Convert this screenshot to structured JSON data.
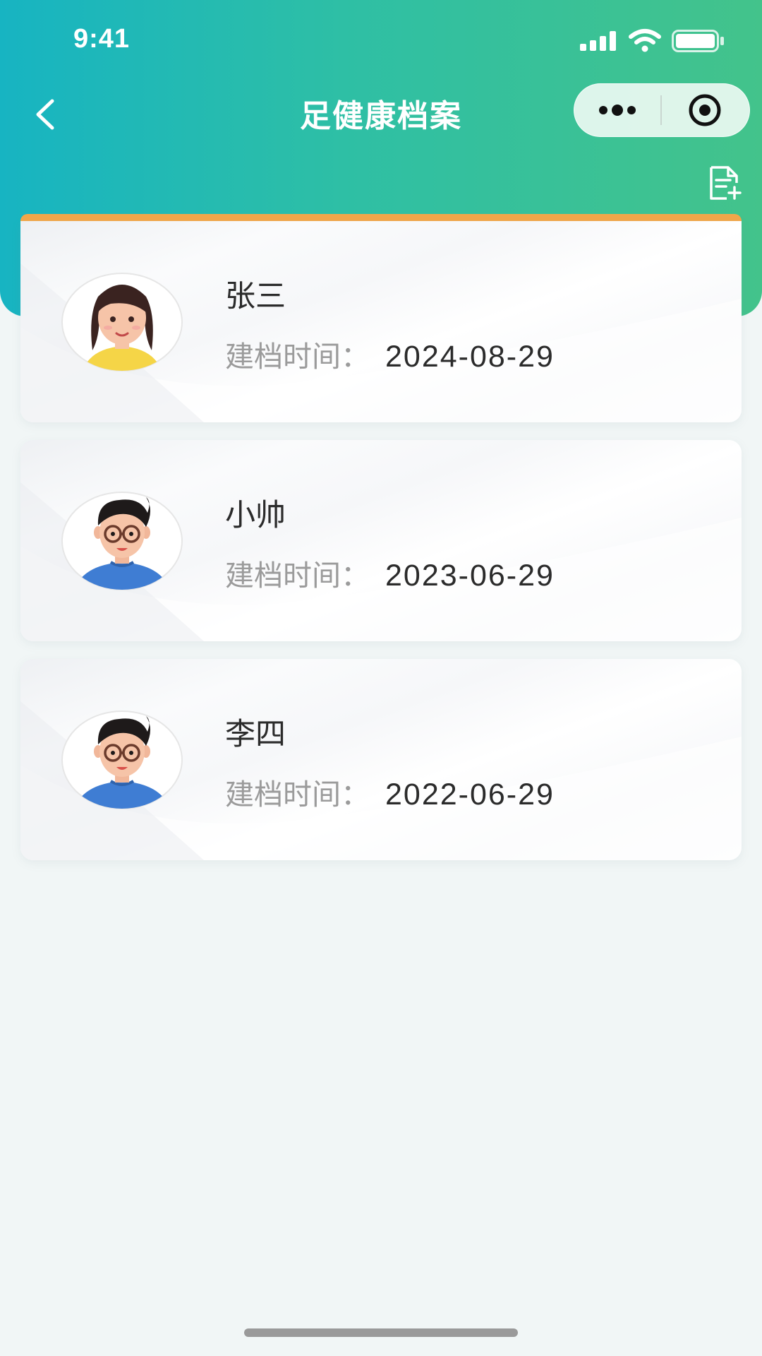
{
  "status_bar": {
    "time": "9:41"
  },
  "nav": {
    "title": "足健康档案",
    "back_icon": "chevron-left-icon",
    "more_icon": "more-dots-icon",
    "close_icon": "target-circle-icon"
  },
  "toolbar": {
    "add_record_icon": "document-add-icon"
  },
  "records": [
    {
      "name": "张三",
      "date_label": "建档时间：",
      "date": "2024-08-29",
      "avatar": "female-avatar"
    },
    {
      "name": "小帅",
      "date_label": "建档时间：",
      "date": "2023-06-29",
      "avatar": "male-avatar"
    },
    {
      "name": "李四",
      "date_label": "建档时间：",
      "date": "2022-06-29",
      "avatar": "male-avatar"
    }
  ],
  "colors": {
    "header_gradient_start": "#17b4c2",
    "header_gradient_end": "#43c38b",
    "accent_strip": "#f2a74a",
    "page_background": "#f1f6f6"
  }
}
